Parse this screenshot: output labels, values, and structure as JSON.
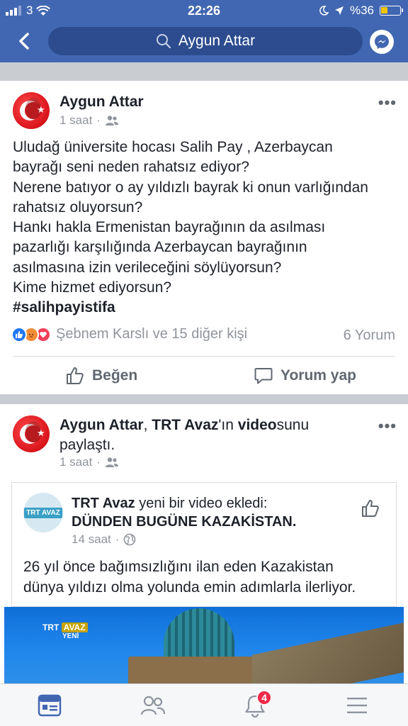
{
  "status_bar": {
    "carrier": "3",
    "time": "22:26",
    "battery": "%36"
  },
  "search": {
    "query": "Aygun Attar"
  },
  "post1": {
    "author": "Aygun Attar",
    "time": "1 saat",
    "privacy_icon": "friends-icon",
    "text_lines": [
      "Uludağ üniversite hocası Salih Pay , Azerbaycan",
      "bayrağı seni neden rahatsız ediyor?",
      "Nerene batıyor o ay yıldızlı bayrak ki onun varlığından",
      "rahatsız oluyorsun?",
      "Hankı hakla Ermenistan bayrağının da asılması",
      "pazarlığı karşılığında Azerbaycan bayrağının",
      "asılmasına izin verileceğini söylüyorsun?",
      "Kime hizmet ediyorsun?"
    ],
    "hashtag": "#salihpayistifa",
    "reactions_text": "Şebnem Karslı ve 15 diğer kişi",
    "comments": "6 Yorum",
    "like_label": "Beğen",
    "comment_label": "Yorum yap"
  },
  "post2": {
    "author": "Aygun Attar",
    "sep": ", ",
    "page": "TRT Avaz",
    "suffix_pre": "'ın ",
    "video_word": "video",
    "suffix_post": "sunu",
    "line2": "paylaştı.",
    "time": "1 saat",
    "shared": {
      "page": "TRT Avaz",
      "action": " yeni bir video ekledi:",
      "title": "DÜNDEN BUGÜNE KAZAKİSTAN.",
      "time": "14 saat",
      "logo_text": "TRT AVAZ",
      "text_lines": [
        "26 yıl önce bağımsızlığını ilan eden Kazakistan",
        "dünya yıldızı olma yolunda emin adımlarla ilerliyor."
      ],
      "watermark_trt": "TRT",
      "watermark_avaz": "AVAZ",
      "watermark_yeni": "YENİ"
    }
  },
  "tabbar": {
    "notifications_count": "4"
  },
  "colors": {
    "brand": "#4267b2",
    "text": "#1d2129",
    "meta": "#90949c",
    "badge": "#f02849"
  }
}
